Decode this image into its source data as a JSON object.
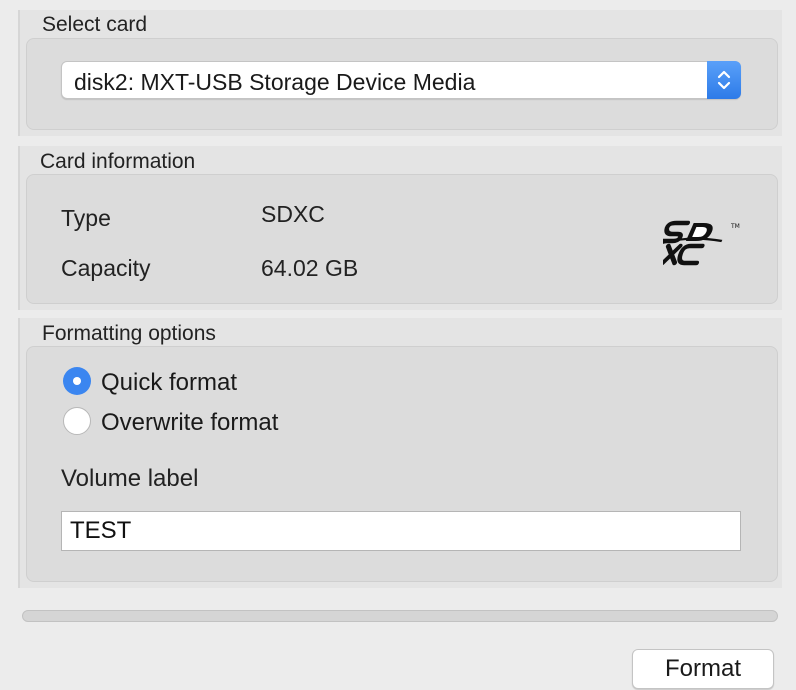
{
  "select_card": {
    "title": "Select card",
    "selected": "disk2: MXT-USB Storage Device Media"
  },
  "card_information": {
    "title": "Card information",
    "type_label": "Type",
    "type_value": "SDXC",
    "capacity_label": "Capacity",
    "capacity_value": "64.02 GB",
    "logo_icon": "sdxc-logo-icon"
  },
  "formatting_options": {
    "title": "Formatting options",
    "options": [
      {
        "label": "Quick format",
        "selected": true
      },
      {
        "label": "Overwrite format",
        "selected": false
      }
    ],
    "volume_label_title": "Volume label",
    "volume_label_value": "TEST"
  },
  "progress": {
    "fraction": 0
  },
  "format_button_label": "Format",
  "colors": {
    "accent": "#3b86f0",
    "background": "#ececec"
  }
}
